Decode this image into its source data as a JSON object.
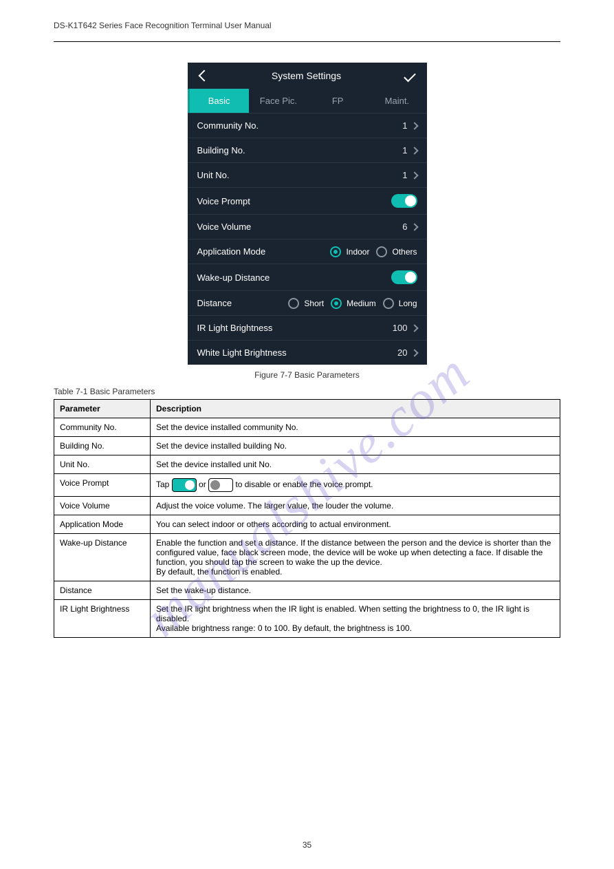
{
  "page": {
    "product": "DS-K1T642 Series Face Recognition Terminal User Manual",
    "figure_caption": "Figure 7-7 Basic Parameters",
    "table_caption": "Table 7-1 Basic Parameters",
    "footer": "35"
  },
  "watermark": "manualshive.com",
  "device": {
    "title": "System Settings",
    "tabs": [
      "Basic",
      "Face Pic.",
      "FP",
      "Maint."
    ],
    "active_tab": 0,
    "rows": {
      "community_no": {
        "label": "Community No.",
        "value": "1"
      },
      "building_no": {
        "label": "Building No.",
        "value": "1"
      },
      "unit_no": {
        "label": "Unit No.",
        "value": "1"
      },
      "voice_prompt": {
        "label": "Voice Prompt",
        "on": true
      },
      "voice_volume": {
        "label": "Voice Volume",
        "value": "6"
      },
      "app_mode": {
        "label": "Application Mode",
        "options": [
          "Indoor",
          "Others"
        ],
        "selected": "Indoor"
      },
      "wakeup": {
        "label": "Wake-up Distance",
        "on": true
      },
      "distance": {
        "label": "Distance",
        "options": [
          "Short",
          "Medium",
          "Long"
        ],
        "selected": "Medium"
      },
      "ir": {
        "label": "IR Light Brightness",
        "value": "100"
      },
      "white": {
        "label": "White Light Brightness",
        "value": "20"
      }
    }
  },
  "table": {
    "headers": [
      "Parameter",
      "Description"
    ],
    "rows": [
      {
        "p": "Community No.",
        "d": "Set the device installed community No."
      },
      {
        "p": "Building No.",
        "d": "Set the device installed building No."
      },
      {
        "p": "Unit No.",
        "d": "Set the device installed unit No."
      },
      {
        "p": "Voice Prompt",
        "d_pre": "Tap ",
        "d_mid": " or ",
        "d_post": " to disable or enable the voice prompt."
      },
      {
        "p": "Voice Volume",
        "d": "Adjust the voice volume. The larger value, the louder the volume."
      },
      {
        "p": "Application Mode",
        "d": "You can select indoor or others according to actual environment."
      },
      {
        "p": "Wake-up Distance",
        "d": "Enable the function and set a distance. If the distance between the person and the device is shorter than the configured value, face black screen mode, the device will be woke up when detecting a face. If disable the function, you should tap the screen to wake the up the device.\nBy default, the function is enabled."
      },
      {
        "p": "Distance",
        "d": "Set the wake-up distance."
      },
      {
        "p": "IR Light Brightness",
        "d": "Set the IR light brightness when the IR light is enabled. When setting the brightness to 0, the IR light is disabled.\nAvailable brightness range: 0 to 100. By default, the brightness is 100."
      }
    ]
  }
}
